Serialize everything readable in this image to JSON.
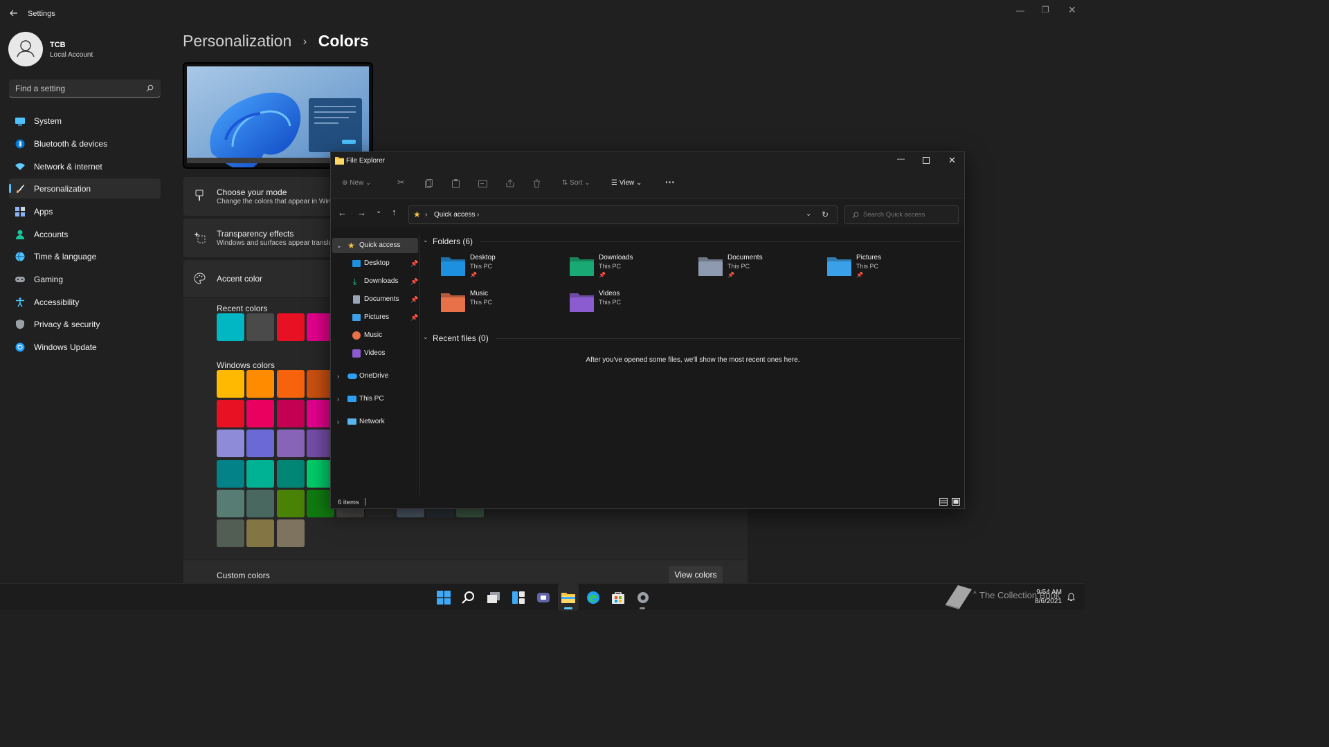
{
  "settings": {
    "app_title": "Settings",
    "user": {
      "name": "TCB",
      "account_type": "Local Account"
    },
    "search": {
      "placeholder": "Find a setting"
    },
    "nav": [
      {
        "label": "System",
        "icon": "monitor-icon",
        "color": "#4cc2ff"
      },
      {
        "label": "Bluetooth & devices",
        "icon": "bluetooth-icon",
        "color": "#0078d4"
      },
      {
        "label": "Network & internet",
        "icon": "wifi-icon",
        "color": "#60cdff"
      },
      {
        "label": "Personalization",
        "icon": "brush-icon",
        "color": "#f7b17c"
      },
      {
        "label": "Apps",
        "icon": "apps-icon",
        "color": "#8ab4f8"
      },
      {
        "label": "Accounts",
        "icon": "person-icon",
        "color": "#19c79c"
      },
      {
        "label": "Time & language",
        "icon": "globe-clock-icon",
        "color": "#4cc2ff"
      },
      {
        "label": "Gaming",
        "icon": "controller-icon",
        "color": "#9aa0a6"
      },
      {
        "label": "Accessibility",
        "icon": "accessibility-icon",
        "color": "#4cc2ff"
      },
      {
        "label": "Privacy & security",
        "icon": "shield-icon",
        "color": "#9aa0a6"
      },
      {
        "label": "Windows Update",
        "icon": "refresh-icon",
        "color": "#1a9fff"
      }
    ],
    "breadcrumb": {
      "parent": "Personalization",
      "separator": "›",
      "current": "Colors"
    },
    "mode_card": {
      "title": "Choose your mode",
      "subtitle": "Change the colors that appear in Win"
    },
    "transparency_card": {
      "title": "Transparency effects",
      "subtitle": "Windows and surfaces appear translu"
    },
    "accent_card": {
      "title": "Accent color"
    },
    "recent_colors": {
      "label": "Recent colors",
      "colors": [
        "#00b7c3",
        "#4a4a4a",
        "#e81123",
        "#e3008c"
      ]
    },
    "windows_colors": {
      "label": "Windows colors",
      "rows": [
        [
          "#ffb900",
          "#ff8c00",
          "#f7630c",
          "#ca5010"
        ],
        [
          "#e81123",
          "#ea005e",
          "#c30052",
          "#e3008c"
        ],
        [
          "#8e8cd8",
          "#6b69d6",
          "#8764b8",
          "#744da9"
        ],
        [
          "#038387",
          "#00b294",
          "#018574",
          "#00cc6a"
        ],
        [
          "#567c73",
          "#486860",
          "#498205",
          "#107c10"
        ],
        [
          "#525e54",
          "#847545",
          "#7e735f"
        ]
      ],
      "peek_row": [
        "#4c4a48",
        "#2d2d2d",
        "#515c6b",
        "#2b3038",
        "#3d5a44"
      ]
    },
    "custom_colors": {
      "label": "Custom colors",
      "button": "View colors"
    }
  },
  "explorer": {
    "title": "File Explorer",
    "toolbar": {
      "new": "New",
      "sort": "Sort",
      "view": "View",
      "more": "···"
    },
    "address": {
      "location": "Quick access",
      "search_placeholder": "Search Quick access"
    },
    "nav_pane": [
      {
        "label": "Quick access",
        "level": 0,
        "icon": "star-icon",
        "expanded": true,
        "selected": true
      },
      {
        "label": "Desktop",
        "level": 1,
        "icon": "desktop-folder-icon",
        "pinned": true
      },
      {
        "label": "Downloads",
        "level": 1,
        "icon": "download-icon",
        "pinned": true
      },
      {
        "label": "Documents",
        "level": 1,
        "icon": "document-icon",
        "pinned": true
      },
      {
        "label": "Pictures",
        "level": 1,
        "icon": "pictures-icon",
        "pinned": true
      },
      {
        "label": "Music",
        "level": 1,
        "icon": "music-icon"
      },
      {
        "label": "Videos",
        "level": 1,
        "icon": "video-icon"
      },
      {
        "label": "OneDrive",
        "level": 0,
        "icon": "cloud-icon",
        "collapsed": true
      },
      {
        "label": "This PC",
        "level": 0,
        "icon": "pc-icon",
        "collapsed": true
      },
      {
        "label": "Network",
        "level": 0,
        "icon": "network-icon",
        "collapsed": true
      }
    ],
    "folders_header": "Folders (6)",
    "folders": [
      {
        "name": "Desktop",
        "location": "This PC",
        "pinned": true,
        "color": "#1e90e0"
      },
      {
        "name": "Downloads",
        "location": "This PC",
        "pinned": true,
        "color": "#19a974"
      },
      {
        "name": "Documents",
        "location": "This PC",
        "pinned": true,
        "color": "#8e9aaf"
      },
      {
        "name": "Pictures",
        "location": "This PC",
        "pinned": true,
        "color": "#3aa0e8"
      },
      {
        "name": "Music",
        "location": "This PC",
        "pinned": false,
        "color": "#e8714a"
      },
      {
        "name": "Videos",
        "location": "This PC",
        "pinned": false,
        "color": "#8a5cd0"
      }
    ],
    "recent_header": "Recent files (0)",
    "recent_empty": "After you've opened some files, we'll show the most recent ones here.",
    "status": "6 items"
  },
  "taskbar": {
    "time": "9:54 AM",
    "date": "8/6/2021",
    "watermark": "The Collection Book"
  }
}
